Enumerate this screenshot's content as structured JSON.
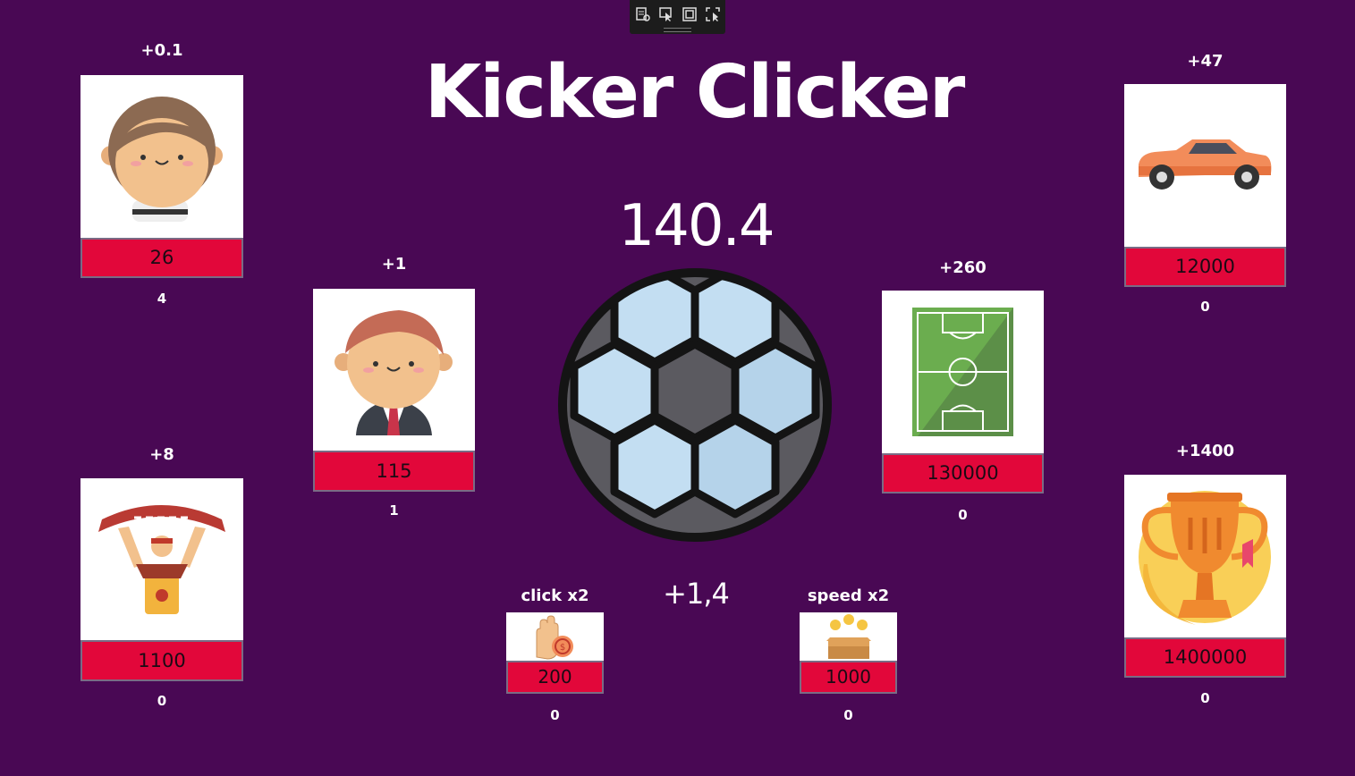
{
  "game": {
    "title": "Kicker Clicker",
    "score": "140.4",
    "rate": "+1,4"
  },
  "toolbar": {
    "icons": [
      "capture-settings-icon",
      "select-cursor-icon",
      "window-capture-icon",
      "region-capture-icon"
    ]
  },
  "cards": {
    "kid": {
      "bonus": "+0.1",
      "price": "26",
      "owned": "4",
      "icon": "kid-player-icon"
    },
    "manager": {
      "bonus": "+1",
      "price": "115",
      "owned": "1",
      "icon": "manager-icon"
    },
    "fan": {
      "bonus": "+8",
      "price": "1100",
      "owned": "0",
      "icon": "fan-scarf-icon"
    },
    "stadium": {
      "bonus": "+260",
      "price": "130000",
      "owned": "0",
      "icon": "football-pitch-icon"
    },
    "car": {
      "bonus": "+47",
      "price": "12000",
      "owned": "0",
      "icon": "car-icon"
    },
    "trophy": {
      "bonus": "+1400",
      "price": "1400000",
      "owned": "0",
      "icon": "trophy-icon"
    }
  },
  "upgrades": {
    "click": {
      "label": "click x2",
      "price": "200",
      "owned": "0",
      "icon": "coin-hand-icon"
    },
    "speed": {
      "label": "speed x2",
      "price": "1000",
      "owned": "0",
      "icon": "money-box-icon"
    }
  },
  "colors": {
    "background": "#490854",
    "price_button": "#e2073a",
    "card": "#ffffff"
  }
}
